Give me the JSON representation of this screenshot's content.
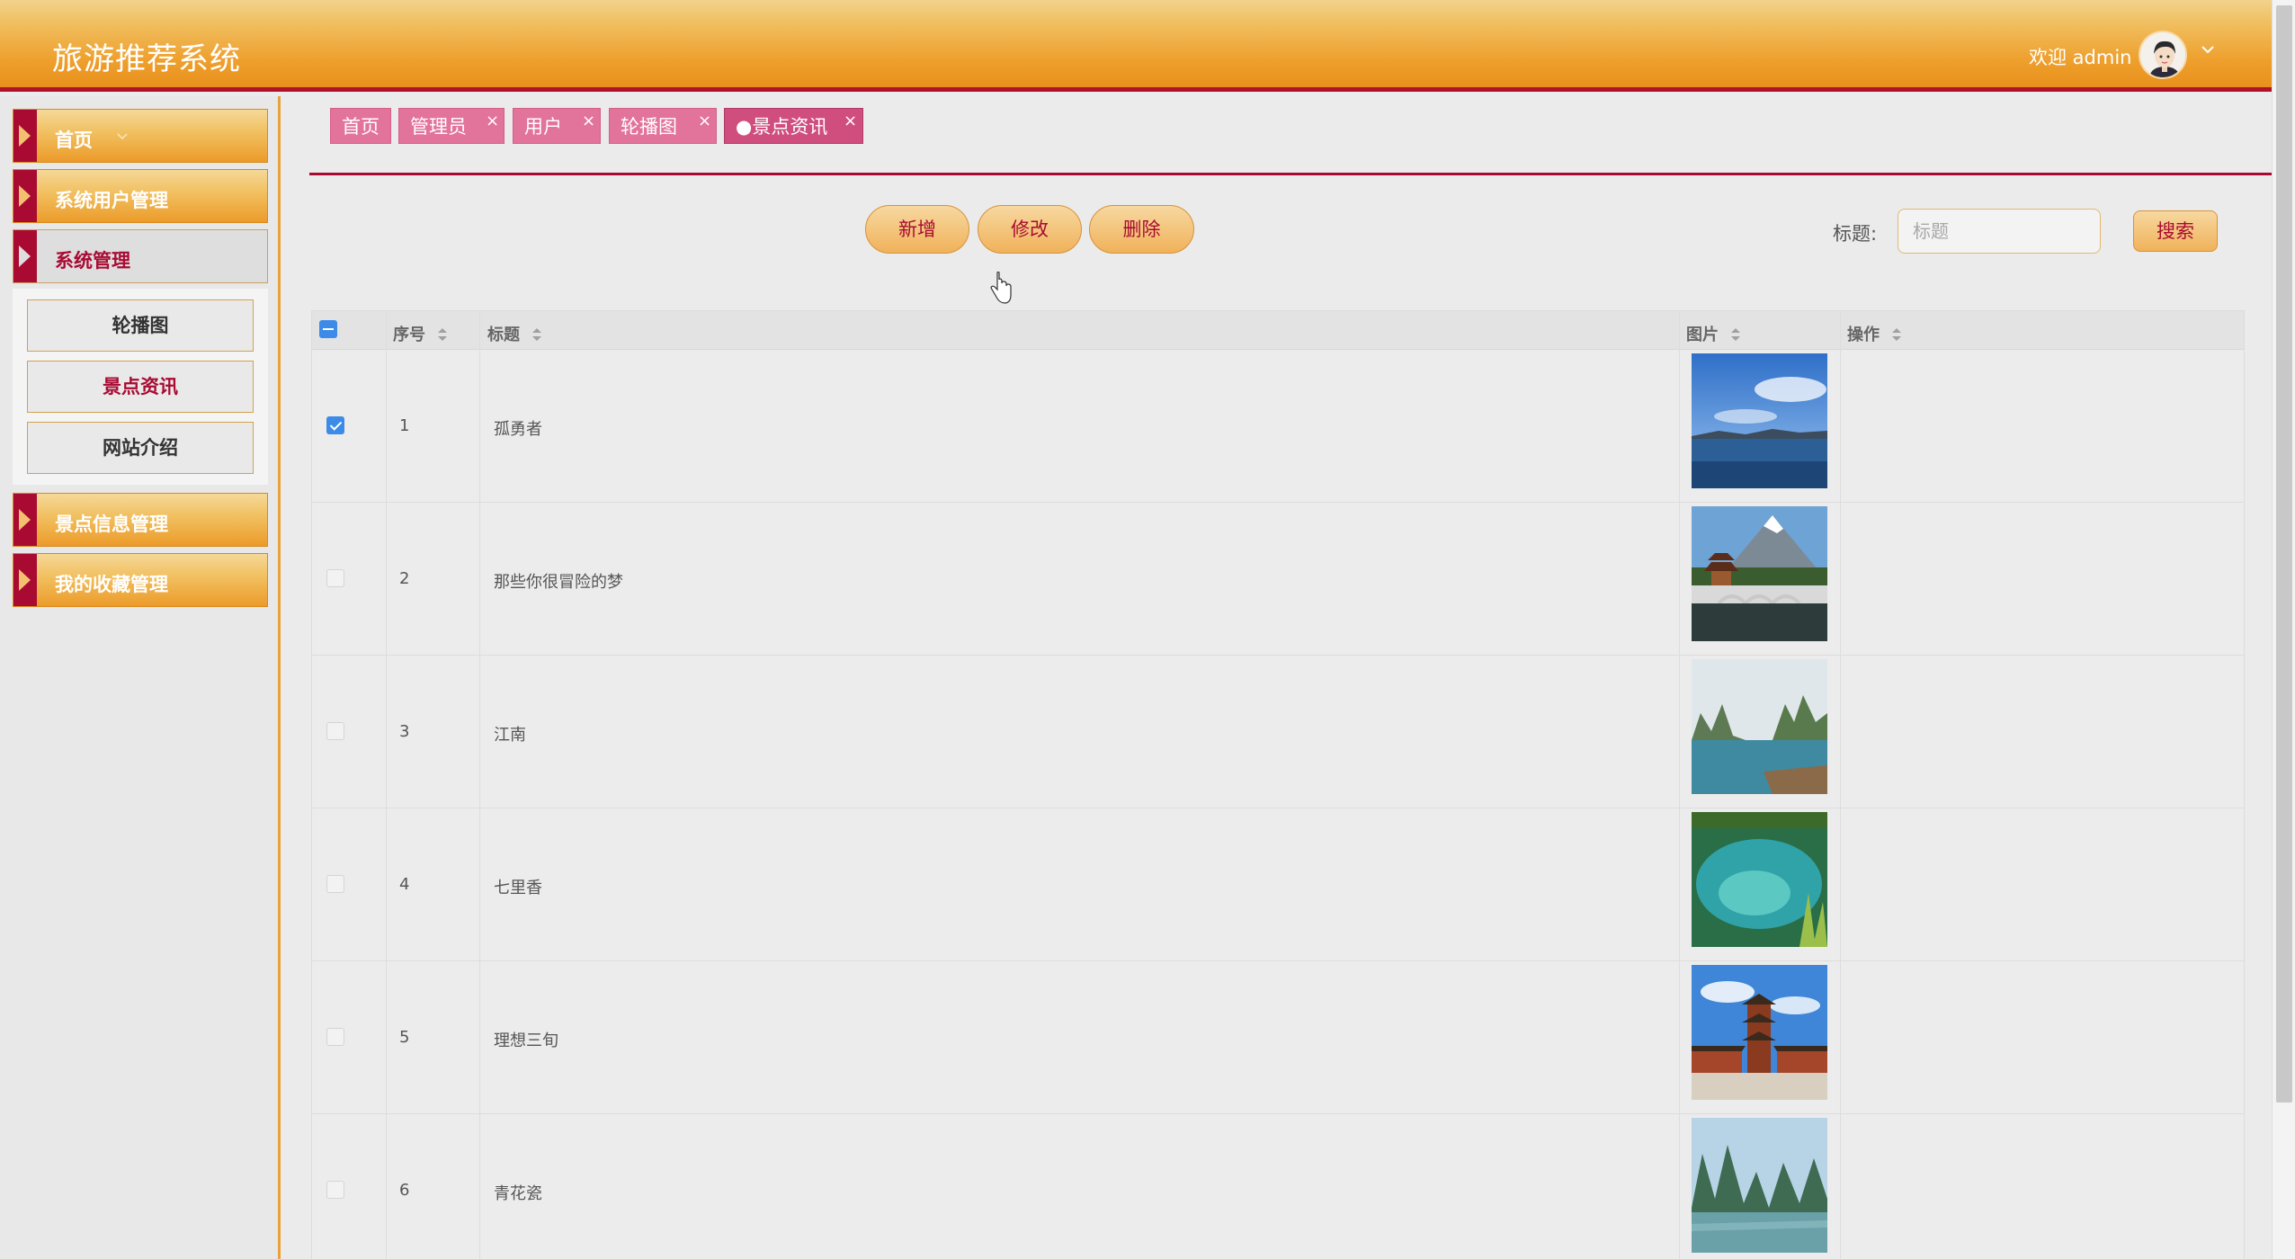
{
  "header": {
    "app_title": "旅游推荐系统",
    "welcome": "欢迎 admin"
  },
  "sidebar": {
    "items": [
      {
        "label": "首页"
      },
      {
        "label": "系统用户管理"
      },
      {
        "label": "系统管理"
      },
      {
        "label": "景点信息管理"
      },
      {
        "label": "我的收藏管理"
      }
    ],
    "submenu": [
      {
        "label": "轮播图"
      },
      {
        "label": "景点资讯"
      },
      {
        "label": "网站介绍"
      }
    ]
  },
  "tabs": [
    {
      "label": "首页"
    },
    {
      "label": "管理员"
    },
    {
      "label": "用户"
    },
    {
      "label": "轮播图"
    },
    {
      "label": "●景点资讯"
    }
  ],
  "toolbar": {
    "add_label": "新增",
    "edit_label": "修改",
    "delete_label": "删除",
    "search_label": "标题:",
    "search_placeholder": "标题",
    "search_button": "搜索"
  },
  "table": {
    "columns": [
      "序号",
      "标题",
      "图片",
      "操作"
    ],
    "rows": [
      {
        "index": "1",
        "title": "孤勇者",
        "checked": true
      },
      {
        "index": "2",
        "title": "那些你很冒险的梦",
        "checked": false
      },
      {
        "index": "3",
        "title": "江南",
        "checked": false
      },
      {
        "index": "4",
        "title": "七里香",
        "checked": false
      },
      {
        "index": "5",
        "title": "理想三旬",
        "checked": false
      },
      {
        "index": "6",
        "title": "青花瓷",
        "checked": false
      }
    ]
  },
  "colors": {
    "header_orange": "#ee9f2c",
    "accent_red": "#a90a32",
    "tab_pink": "#e2739a",
    "checkbox_blue": "#3d8be8"
  }
}
